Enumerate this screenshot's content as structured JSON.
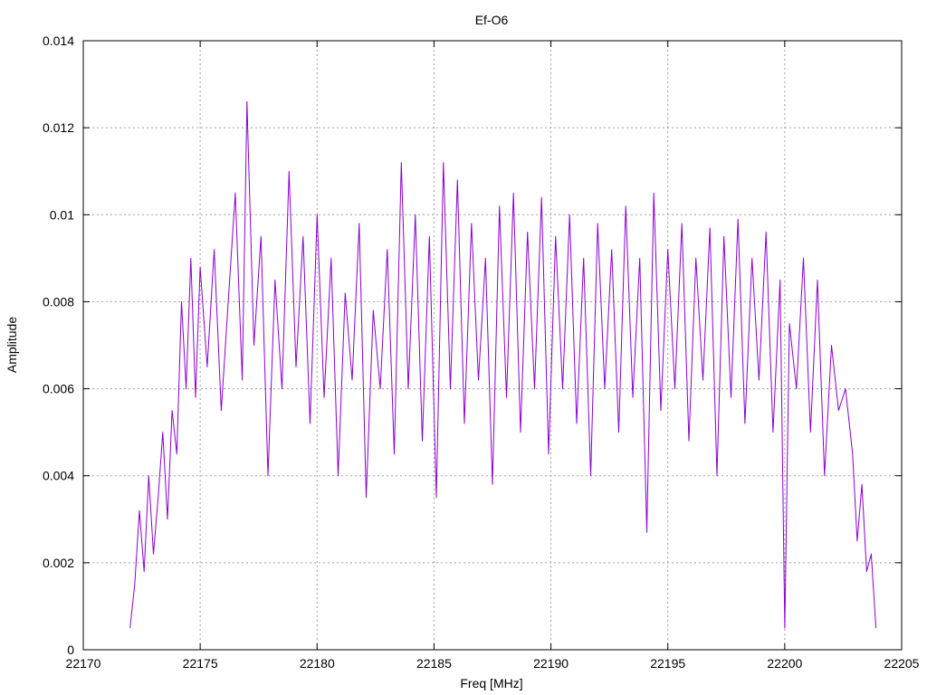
{
  "chart_data": {
    "type": "line",
    "title": "Ef-O6",
    "xlabel": "Freq [MHz]",
    "ylabel": "Amplitude",
    "xlim": [
      22170,
      22205
    ],
    "ylim": [
      0,
      0.014
    ],
    "xticks": [
      "22170",
      "22175",
      "22180",
      "22185",
      "22190",
      "22195",
      "22200",
      "22205"
    ],
    "yticks": [
      "0",
      "0.002",
      "0.004",
      "0.006",
      "0.008",
      "0.01",
      "0.012",
      "0.014"
    ],
    "grid": true,
    "series_color": "#8b00d0",
    "series": [
      {
        "name": "",
        "x": [
          22172.0,
          22172.2,
          22172.4,
          22172.6,
          22172.8,
          22173.0,
          22173.2,
          22173.4,
          22173.6,
          22173.8,
          22174.0,
          22174.2,
          22174.4,
          22174.6,
          22174.8,
          22175.0,
          22175.3,
          22175.6,
          22175.9,
          22176.2,
          22176.5,
          22176.8,
          22177.0,
          22177.3,
          22177.6,
          22177.9,
          22178.2,
          22178.5,
          22178.8,
          22179.1,
          22179.4,
          22179.7,
          22180.0,
          22180.3,
          22180.6,
          22180.9,
          22181.2,
          22181.5,
          22181.8,
          22182.1,
          22182.4,
          22182.7,
          22183.0,
          22183.3,
          22183.6,
          22183.9,
          22184.2,
          22184.5,
          22184.8,
          22185.1,
          22185.4,
          22185.7,
          22186.0,
          22186.3,
          22186.6,
          22186.9,
          22187.2,
          22187.5,
          22187.8,
          22188.1,
          22188.4,
          22188.7,
          22189.0,
          22189.3,
          22189.6,
          22189.9,
          22190.2,
          22190.5,
          22190.8,
          22191.1,
          22191.4,
          22191.7,
          22192.0,
          22192.3,
          22192.6,
          22192.9,
          22193.2,
          22193.5,
          22193.8,
          22194.1,
          22194.4,
          22194.7,
          22195.0,
          22195.3,
          22195.6,
          22195.9,
          22196.2,
          22196.5,
          22196.8,
          22197.1,
          22197.4,
          22197.7,
          22198.0,
          22198.3,
          22198.6,
          22198.9,
          22199.2,
          22199.5,
          22199.8,
          22200.0,
          22200.2,
          22200.5,
          22200.8,
          22201.1,
          22201.4,
          22201.7,
          22202.0,
          22202.3,
          22202.6,
          22202.9,
          22203.1,
          22203.3,
          22203.5,
          22203.7,
          22203.9
        ],
        "y": [
          0.0005,
          0.0015,
          0.0032,
          0.0018,
          0.004,
          0.0022,
          0.0035,
          0.005,
          0.003,
          0.0055,
          0.0045,
          0.008,
          0.006,
          0.009,
          0.0058,
          0.0088,
          0.0065,
          0.0092,
          0.0055,
          0.008,
          0.0105,
          0.0062,
          0.0126,
          0.007,
          0.0095,
          0.004,
          0.0085,
          0.006,
          0.011,
          0.0065,
          0.0095,
          0.0052,
          0.01,
          0.0058,
          0.009,
          0.004,
          0.0082,
          0.0062,
          0.0098,
          0.0035,
          0.0078,
          0.006,
          0.0092,
          0.0045,
          0.0112,
          0.006,
          0.01,
          0.0048,
          0.0095,
          0.0035,
          0.0112,
          0.006,
          0.0108,
          0.0052,
          0.0098,
          0.0062,
          0.009,
          0.0038,
          0.0102,
          0.0058,
          0.0105,
          0.005,
          0.0096,
          0.006,
          0.0104,
          0.0045,
          0.0095,
          0.006,
          0.01,
          0.0052,
          0.009,
          0.004,
          0.0098,
          0.006,
          0.0092,
          0.005,
          0.0102,
          0.0058,
          0.009,
          0.0027,
          0.0105,
          0.0055,
          0.0092,
          0.006,
          0.0098,
          0.0048,
          0.009,
          0.0062,
          0.0097,
          0.004,
          0.0095,
          0.0058,
          0.0099,
          0.0052,
          0.009,
          0.0062,
          0.0096,
          0.005,
          0.0085,
          0.0005,
          0.0075,
          0.006,
          0.009,
          0.005,
          0.0085,
          0.004,
          0.007,
          0.0055,
          0.006,
          0.0045,
          0.0025,
          0.0038,
          0.0018,
          0.0022,
          0.0005
        ]
      }
    ]
  }
}
